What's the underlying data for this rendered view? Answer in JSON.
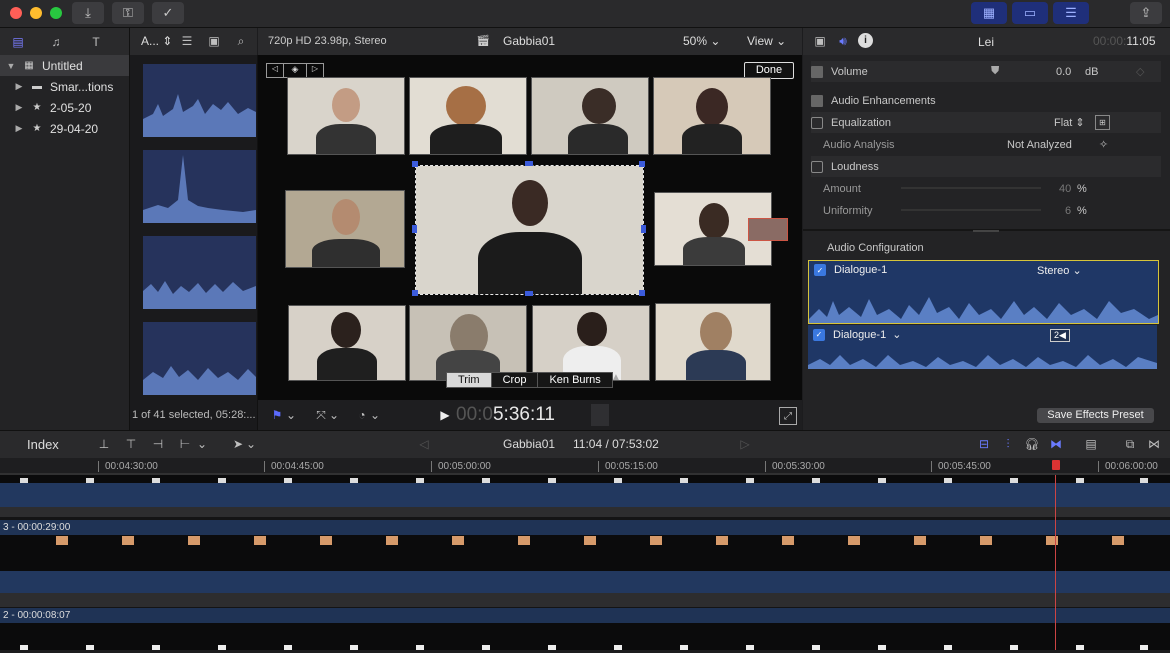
{
  "toolbar": {
    "traffic_colors": [
      "#ff5f57",
      "#febc2e",
      "#28c840"
    ]
  },
  "library": {
    "items": [
      {
        "label": "Untitled",
        "selected": true
      },
      {
        "label": "Smar...tions"
      },
      {
        "label": "2-05-20"
      },
      {
        "label": "29-04-20"
      }
    ],
    "sort_label": "A..."
  },
  "browser": {
    "status": "1 of 41 selected, 05:28:..."
  },
  "viewer": {
    "format": "720p HD 23.98p, Stereo",
    "clip_name": "Gabbia01",
    "zoom": "50%",
    "view_label": "View",
    "done_label": "Done",
    "timecode_dim": "00:0",
    "timecode": "5:36:11",
    "tools": [
      "Trim",
      "Crop",
      "Ken Burns"
    ],
    "active_tool": "Crop"
  },
  "inspector": {
    "title": "Lei",
    "timecode_dim": "00:00:",
    "timecode": "11:05",
    "volume_label": "Volume",
    "volume_value": "0.0",
    "volume_unit": "dB",
    "enhancements_label": "Audio Enhancements",
    "equalization_label": "Equalization",
    "equalization_value": "Flat",
    "analysis_label": "Audio Analysis",
    "analysis_value": "Not Analyzed",
    "loudness_label": "Loudness",
    "amount_label": "Amount",
    "amount_value": "40",
    "uniformity_label": "Uniformity",
    "uniformity_value": "6",
    "percent": "%",
    "config_label": "Audio Configuration",
    "dialogue1_label": "Dialogue-1",
    "dialogue1_mode": "Stereo",
    "dialogue2_label": "Dialogue-1",
    "dialogue2_badge": "2",
    "save_preset_label": "Save Effects Preset"
  },
  "timeline": {
    "index_label": "Index",
    "project_name": "Gabbia01",
    "position": "11:04 / 07:53:02",
    "ruler": [
      "00:04:30:00",
      "00:04:45:00",
      "00:05:00:00",
      "00:05:15:00",
      "00:05:30:00",
      "00:05:45:00",
      "00:06:00:00"
    ],
    "lane3_label": "3 - 00:00:29:00",
    "lane2_label": "2 - 00:00:08:07"
  }
}
